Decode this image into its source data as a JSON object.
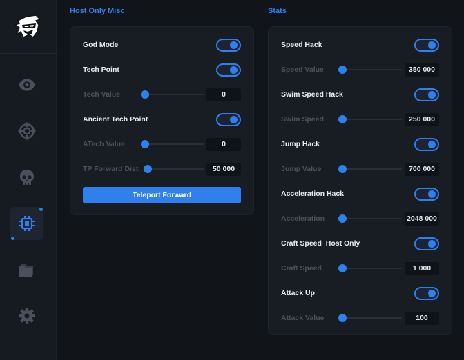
{
  "sidebar": {
    "logo": "ninja-logo",
    "items": [
      {
        "icon": "eye-icon",
        "active": false
      },
      {
        "icon": "crosshair-icon",
        "active": false
      },
      {
        "icon": "skull-icon",
        "active": false
      },
      {
        "icon": "chip-icon",
        "active": true
      },
      {
        "icon": "folder-icon",
        "active": false
      },
      {
        "icon": "gear-icon",
        "active": false
      }
    ]
  },
  "colors": {
    "accent": "#2f80ed",
    "panel": "#181c23",
    "background": "#111419"
  },
  "left": {
    "title": "Host Only Misc",
    "god_mode": {
      "label": "God Mode",
      "on": true
    },
    "tech_point": {
      "label": "Tech Point",
      "on": true
    },
    "tech_value": {
      "label": "Tech Value",
      "value": "0",
      "level": 0
    },
    "ancient_tech_point": {
      "label": "Ancient Tech Point",
      "on": true
    },
    "atech_value": {
      "label": "ATech Value",
      "value": "0",
      "level": 0
    },
    "tp_forward_dist": {
      "label": "TP Forward Dist",
      "value": "50 000",
      "level": 0.05
    },
    "teleport_button": "Teleport Forward"
  },
  "right": {
    "title": "Stats",
    "speed_hack": {
      "label": "Speed Hack",
      "on": true
    },
    "speed_value": {
      "label": "Speed Value",
      "value": "350 000",
      "level": 0
    },
    "swim_speed_hack": {
      "label": "Swim Speed Hack",
      "on": true
    },
    "swim_speed": {
      "label": "Swim Speed",
      "value": "250 000",
      "level": 0
    },
    "jump_hack": {
      "label": "Jump Hack",
      "on": true
    },
    "jump_value": {
      "label": "Jump Value",
      "value": "700 000",
      "level": 0
    },
    "acceleration_hack": {
      "label": "Acceleration Hack",
      "on": true
    },
    "acceleration": {
      "label": "Acceleration",
      "value": "2048 000",
      "level": 0
    },
    "craft_speed": {
      "label": "Craft Speed  Host Only",
      "on": true
    },
    "craft_speed_value": {
      "label": "Craft Speed",
      "value": "1 000",
      "level": 0
    },
    "attack_up": {
      "label": "Attack Up",
      "on": true
    },
    "attack_value": {
      "label": "Attack Value",
      "value": "100",
      "level": 0
    }
  }
}
